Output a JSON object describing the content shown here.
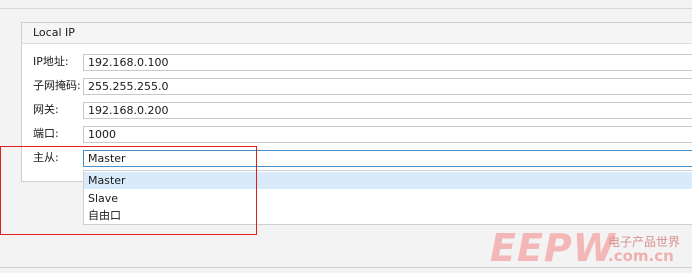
{
  "group": {
    "title": "Local IP"
  },
  "fields": [
    {
      "label": "IP地址:",
      "value": "192.168.0.100"
    },
    {
      "label": "子网掩码:",
      "value": "255.255.255.0"
    },
    {
      "label": "网关:",
      "value": "192.168.0.200"
    },
    {
      "label": "端口:",
      "value": "1000"
    }
  ],
  "role": {
    "label": "主从:",
    "value": "Master",
    "options": [
      "Master",
      "Slave",
      "自由口"
    ],
    "highlighted_option": "Master"
  },
  "watermark": {
    "brand": "EEPW",
    "chinese": "电子产品世界",
    "url": ".com.cn"
  },
  "colors": {
    "highlight_box": "#e0201c",
    "focus_border": "#4a90c8",
    "option_selected_bg": "#d9ebfa"
  }
}
